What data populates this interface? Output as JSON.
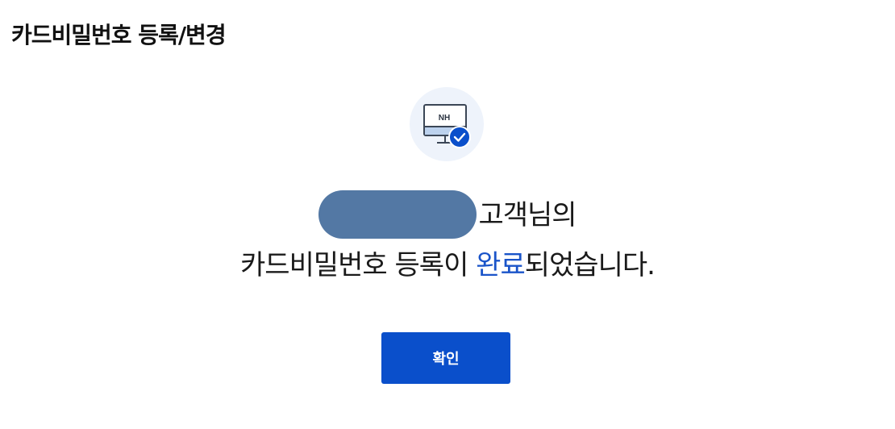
{
  "page": {
    "title": "카드비밀번호 등록/변경"
  },
  "status_icon": {
    "name": "monitor-check-icon",
    "monitor_label": "NH",
    "badge_icon": "check-badge-icon"
  },
  "message": {
    "customer_name_masked": true,
    "line1_suffix": "고객님의",
    "line2_prefix": "카드비밀번호 등록이 ",
    "line2_highlight": "완료",
    "line2_suffix": "되었습니다."
  },
  "actions": {
    "confirm_label": "확인"
  },
  "colors": {
    "accent": "#1a54c9",
    "button": "#0a4fcb",
    "name_mask": "#5378a4",
    "icon_background": "#eef3fb"
  }
}
